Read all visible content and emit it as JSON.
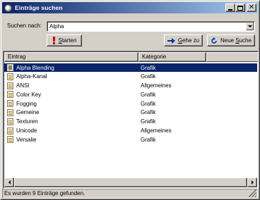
{
  "window": {
    "title": "Einträge suchen",
    "controls": {
      "minimize": "minimize",
      "maximize": "maximize",
      "close": "close"
    }
  },
  "search": {
    "label": "Suchen nach:",
    "value": "Alpha"
  },
  "buttons": {
    "start_label": "Starten",
    "start_mnemonic": "S",
    "goto_label": "Gehe zu",
    "goto_mnemonic": "G",
    "new_search_label": "Neue Suche",
    "new_search_mnemonic": "S"
  },
  "list": {
    "columns": [
      "Eintrag",
      "Kategorie"
    ],
    "rows": [
      {
        "entry": "Alpha Blending",
        "category": "Grafik",
        "selected": true
      },
      {
        "entry": "Alpha-Kanal",
        "category": "Grafik",
        "selected": false
      },
      {
        "entry": "ANSI",
        "category": "Allgemeines",
        "selected": false
      },
      {
        "entry": "Color Key",
        "category": "Grafik",
        "selected": false
      },
      {
        "entry": "Fogging",
        "category": "Grafik",
        "selected": false
      },
      {
        "entry": "Gemeine",
        "category": "Grafik",
        "selected": false
      },
      {
        "entry": "Texturen",
        "category": "Grafik",
        "selected": false
      },
      {
        "entry": "Unicode",
        "category": "Allgemeines",
        "selected": false
      },
      {
        "entry": "Versalie",
        "category": "Grafik",
        "selected": false
      }
    ]
  },
  "status": {
    "text": "Es wurden 9 Einträge gefunden."
  },
  "colors": {
    "title_start": "#0a246a",
    "title_end": "#a6caf0",
    "selection": "#0a246a",
    "face": "#d4d0c8",
    "start_icon": "#cc0000",
    "goto_icon": "#0033aa",
    "new_search_icon": "#0033aa"
  },
  "icons": {
    "window": "app-globe-icon",
    "start": "exclamation-icon",
    "goto": "arrow-right-icon",
    "new_search": "refresh-icon",
    "entry": "document-icon"
  }
}
